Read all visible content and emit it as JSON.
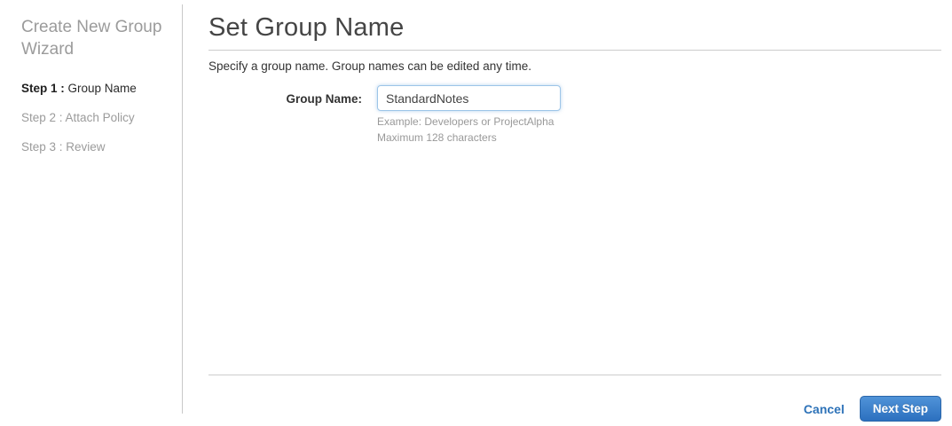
{
  "sidebar": {
    "title": "Create New Group Wizard",
    "steps": [
      {
        "prefix": "Step 1 :",
        "label": " Group Name"
      },
      {
        "prefix": "Step 2 :",
        "label": " Attach Policy"
      },
      {
        "prefix": "Step 3 :",
        "label": " Review"
      }
    ]
  },
  "main": {
    "title": "Set Group Name",
    "description": "Specify a group name. Group names can be edited any time.",
    "form": {
      "label": "Group Name:",
      "value": "StandardNotes",
      "hint_example": "Example: Developers or ProjectAlpha",
      "hint_max": "Maximum 128 characters"
    },
    "footer": {
      "cancel": "Cancel",
      "next": "Next Step"
    }
  },
  "colors": {
    "link_blue": "#2d72b8",
    "button_gradient_top": "#5093d8",
    "button_gradient_bottom": "#2c70bf",
    "input_focus_border": "#9dc5e8",
    "muted_gray": "#9b9b9b",
    "rule_gray": "#cccccc"
  }
}
